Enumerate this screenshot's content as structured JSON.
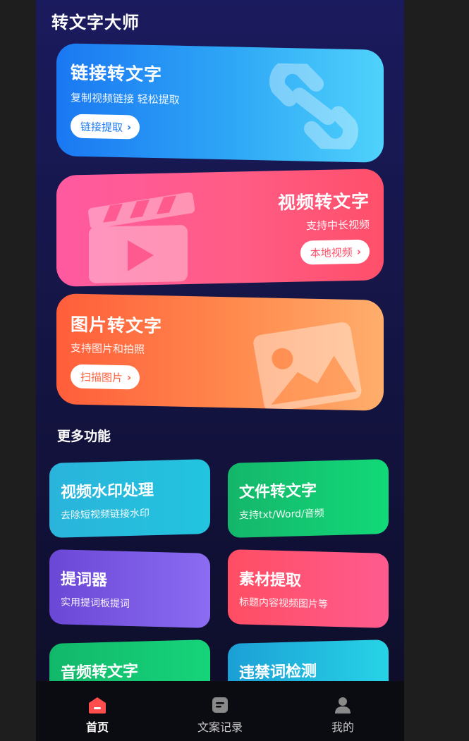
{
  "app": {
    "title": "转文字大师"
  },
  "cards": {
    "link": {
      "title": "链接转文字",
      "subtitle": "复制视频链接 轻松提取",
      "button": "链接提取",
      "color": "#1a78f2"
    },
    "video": {
      "title": "视频转文字",
      "subtitle": "支持中长视频",
      "button": "本地视频",
      "color": "#ff5a86"
    },
    "image": {
      "title": "图片转文字",
      "subtitle": "支持图片和拍照",
      "button": "扫描图片",
      "color": "#ff6e45"
    }
  },
  "more": {
    "title": "更多功能",
    "items": [
      {
        "title": "视频水印处理",
        "subtitle": "去除短视频链接水印"
      },
      {
        "title": "文件转文字",
        "subtitle": "支持txt/Word/音频"
      },
      {
        "title": "提词器",
        "subtitle": "实用提词板提词"
      },
      {
        "title": "素材提取",
        "subtitle": "标题内容视频图片等"
      },
      {
        "title": "音频转文字",
        "subtitle": ""
      },
      {
        "title": "违禁词检测",
        "subtitle": ""
      }
    ]
  },
  "tabs": [
    {
      "label": "首页",
      "icon": "home-icon",
      "active": true
    },
    {
      "label": "文案记录",
      "icon": "document-icon",
      "active": false
    },
    {
      "label": "我的",
      "icon": "user-icon",
      "active": false
    }
  ],
  "colors": {
    "accent": "#ff4d4d",
    "background": "#16164a"
  }
}
